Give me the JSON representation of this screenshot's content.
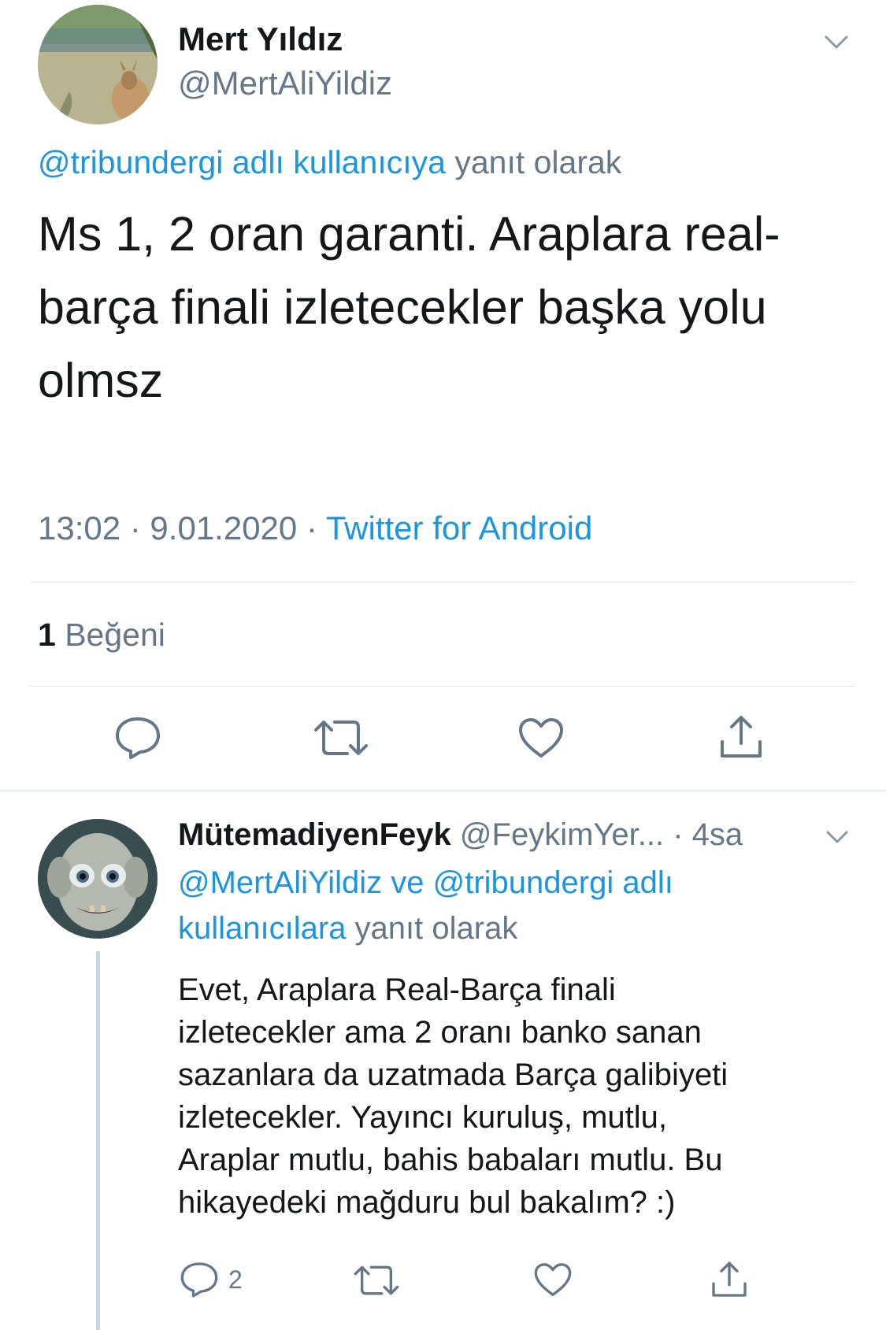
{
  "main_tweet": {
    "author_name": "Mert Yıldız",
    "author_handle": "@MertAliYildiz",
    "reply_to_handle": "@tribundergi adlı kullanıcıya",
    "reply_suffix": " yanıt olarak",
    "text_lines": [
      "Ms 1, 2 oran garanti. Araplara real-",
      "barça finali izletecekler başka yolu",
      "olmsz"
    ],
    "time_date": "13:02 · 9.01.2020 · ",
    "source": "Twitter for Android",
    "likes_count": "1",
    "likes_label": " Beğeni",
    "icons": [
      "avatar-kangaroo",
      "chevron-down-icon",
      "reply-icon",
      "retweet-icon",
      "like-icon",
      "share-icon"
    ]
  },
  "reply_tweet": {
    "author_name": "MütemadiyenFeyk",
    "author_handle": "@FeykimYer...",
    "time": " · 4sa",
    "reply_ctx_links_1": "@MertAliYildiz ve @tribundergi adlı",
    "reply_ctx_links_2": "kullanıcılara",
    "reply_suffix": " yanıt olarak",
    "text_lines": [
      "Evet, Araplara Real-Barça finali",
      "izletecekler ama 2 oranı banko sanan",
      "sazanlara da uzatmada Barça galibiyeti",
      "izletecekler. Yayıncı kuruluş, mutlu,",
      "Araplar mutlu, bahis babaları mutlu. Bu",
      "hikayedeki mağduru bul bakalım? :)"
    ],
    "reply_count": "2",
    "icons": [
      "avatar-gollum",
      "chevron-down-icon",
      "reply-icon",
      "retweet-icon",
      "like-icon",
      "share-icon"
    ]
  },
  "colors": {
    "link": "#1b95e0",
    "secondary_text": "#657786",
    "primary_text": "#14171a",
    "divider": "#e1e8ed"
  }
}
